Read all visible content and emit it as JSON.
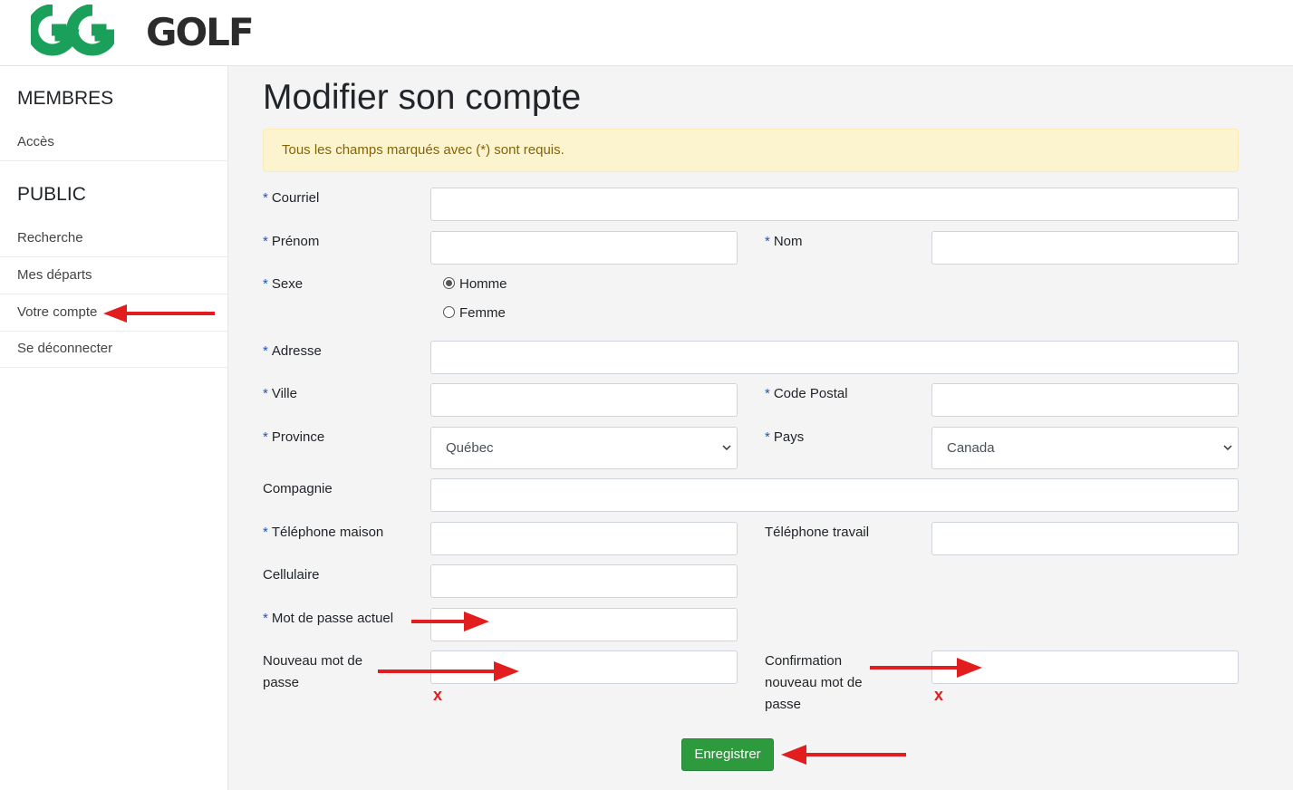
{
  "brand": {
    "logo_text": "GOLF",
    "logo_mark": "GG",
    "colors": {
      "green": "#1aa05a",
      "dark": "#2b2b2b"
    }
  },
  "sidebar": {
    "sections": [
      {
        "heading": "MEMBRES",
        "items": [
          {
            "label": "Accès"
          }
        ]
      },
      {
        "heading": "PUBLIC",
        "items": [
          {
            "label": "Recherche"
          },
          {
            "label": "Mes départs"
          },
          {
            "label": "Votre compte"
          },
          {
            "label": "Se déconnecter"
          }
        ]
      }
    ]
  },
  "page": {
    "title": "Modifier son compte",
    "alert": "Tous les champs marqués avec (*) sont requis."
  },
  "form": {
    "required_marker": "*",
    "courriel": {
      "label": "Courriel",
      "value": ""
    },
    "prenom": {
      "label": "Prénom",
      "value": ""
    },
    "nom": {
      "label": "Nom",
      "value": ""
    },
    "sexe": {
      "label": "Sexe",
      "options": [
        "Homme",
        "Femme"
      ],
      "selected": "Homme"
    },
    "adresse": {
      "label": "Adresse",
      "value": ""
    },
    "ville": {
      "label": "Ville",
      "value": ""
    },
    "code_postal": {
      "label": "Code Postal",
      "value": ""
    },
    "province": {
      "label": "Province",
      "value": "Québec"
    },
    "pays": {
      "label": "Pays",
      "value": "Canada"
    },
    "compagnie": {
      "label": "Compagnie",
      "value": ""
    },
    "tel_maison": {
      "label": "Téléphone maison",
      "value": ""
    },
    "tel_travail": {
      "label": "Téléphone travail",
      "value": ""
    },
    "cellulaire": {
      "label": "Cellulaire",
      "value": ""
    },
    "mdp_actuel": {
      "label": "Mot de passe actuel",
      "value": ""
    },
    "nouveau_mdp": {
      "label_line1": "Nouveau mot de",
      "label_line2": "passe",
      "value": ""
    },
    "confirmation_mdp": {
      "label_line1": "Confirmation",
      "label_line2": "nouveau mot de",
      "label_line3": "passe",
      "value": ""
    },
    "error_mark": "x",
    "submit_label": "Enregistrer"
  },
  "annotations": {
    "arrow_color": "#e21d1d"
  }
}
